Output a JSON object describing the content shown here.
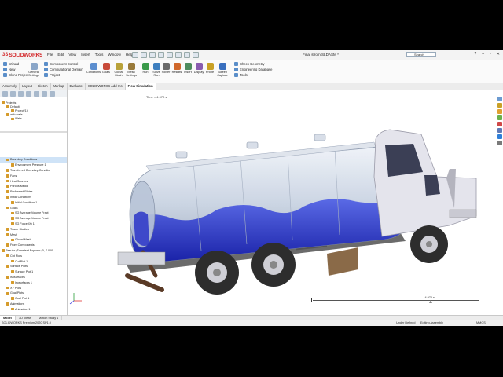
{
  "app": {
    "logo_ds": "3S",
    "logo_text": "SOLIDWORKS",
    "document_title": "Final strom SLDASM *",
    "search_placeholder": "Search"
  },
  "menu": [
    "File",
    "Edit",
    "View",
    "Insert",
    "Tools",
    "Window",
    "Help"
  ],
  "ribbon": {
    "col1": [
      "Wizard",
      "New",
      "Clone Project"
    ],
    "col2": [
      "General Settings"
    ],
    "col3": [
      "Component Control",
      "Computational Domain",
      "Project"
    ],
    "big_buttons": [
      "Conditions",
      "Goals",
      "Global Mesh",
      "Mesh Settings",
      "Run",
      "Solve Run",
      "Solver",
      "Results",
      "Insert",
      "Display",
      "Probe",
      "Screen Capture"
    ],
    "col4": [
      "Check Geometry",
      "Engineering Database",
      "Tools"
    ]
  },
  "tabs": [
    "Assembly",
    "Layout",
    "Sketch",
    "Markup",
    "Evaluate",
    "SOLIDWORKS Add-Ins",
    "Flow Simulation"
  ],
  "active_tab": "Flow Simulation",
  "tree_top": [
    {
      "label": "Projects",
      "indent": 0
    },
    {
      "label": "Default",
      "indent": 1
    },
    {
      "label": "Project(1)",
      "indent": 2
    },
    {
      "label": "with walls",
      "indent": 1
    },
    {
      "label": "Walls",
      "indent": 2
    }
  ],
  "tree_bottom": [
    {
      "label": "Boundary Conditions",
      "indent": 1,
      "selected": true
    },
    {
      "label": "Environment Pressure 1",
      "indent": 2
    },
    {
      "label": "Transferred Boundary Conditio",
      "indent": 1
    },
    {
      "label": "Fans",
      "indent": 1
    },
    {
      "label": "Heat Sources",
      "indent": 1
    },
    {
      "label": "Porous Media",
      "indent": 1
    },
    {
      "label": "Perforated Plates",
      "indent": 1
    },
    {
      "label": "Initial Conditions",
      "indent": 1
    },
    {
      "label": "Initial Condition 1",
      "indent": 2
    },
    {
      "label": "Goals",
      "indent": 1
    },
    {
      "label": "SG Average Volume Fract",
      "indent": 2
    },
    {
      "label": "SG Average Volume Fract",
      "indent": 2
    },
    {
      "label": "SG Force (X) 1",
      "indent": 2
    },
    {
      "label": "Tracer Studies",
      "indent": 1
    },
    {
      "label": "Mesh",
      "indent": 1
    },
    {
      "label": "Global Mesh",
      "indent": 2
    },
    {
      "label": "From Components",
      "indent": 1
    },
    {
      "label": "Results (Transient Explorer (0, 7.000",
      "indent": 0
    },
    {
      "label": "Cut Plots",
      "indent": 1
    },
    {
      "label": "Cut Plot 1",
      "indent": 2
    },
    {
      "label": "Surface Plots",
      "indent": 1
    },
    {
      "label": "Surface Plot 1",
      "indent": 2
    },
    {
      "label": "Isosurfaces",
      "indent": 1
    },
    {
      "label": "Isosurfaces 1",
      "indent": 2
    },
    {
      "label": "XY Plots",
      "indent": 1
    },
    {
      "label": "Goal Plots",
      "indent": 1
    },
    {
      "label": "Goal Plot 1",
      "indent": 2
    },
    {
      "label": "Animations",
      "indent": 1
    },
    {
      "label": "Animation 1",
      "indent": 2
    }
  ],
  "viewport": {
    "time_label": "Time = 4.970 s",
    "slider_time": "4.970 s",
    "slider_fraction": 0.71
  },
  "bottom_tabs": [
    "Model",
    "3D Views",
    "Motion Study 1"
  ],
  "status": {
    "left": "SOLIDWORKS Premium 2020 SP1.0",
    "mid": "Under Defined",
    "edit": "Editing Assembly",
    "units": "MMGS"
  },
  "colors": {
    "fluid": "#2a35c8",
    "tank": "#c8d4e6",
    "accent": "#d3272a"
  }
}
